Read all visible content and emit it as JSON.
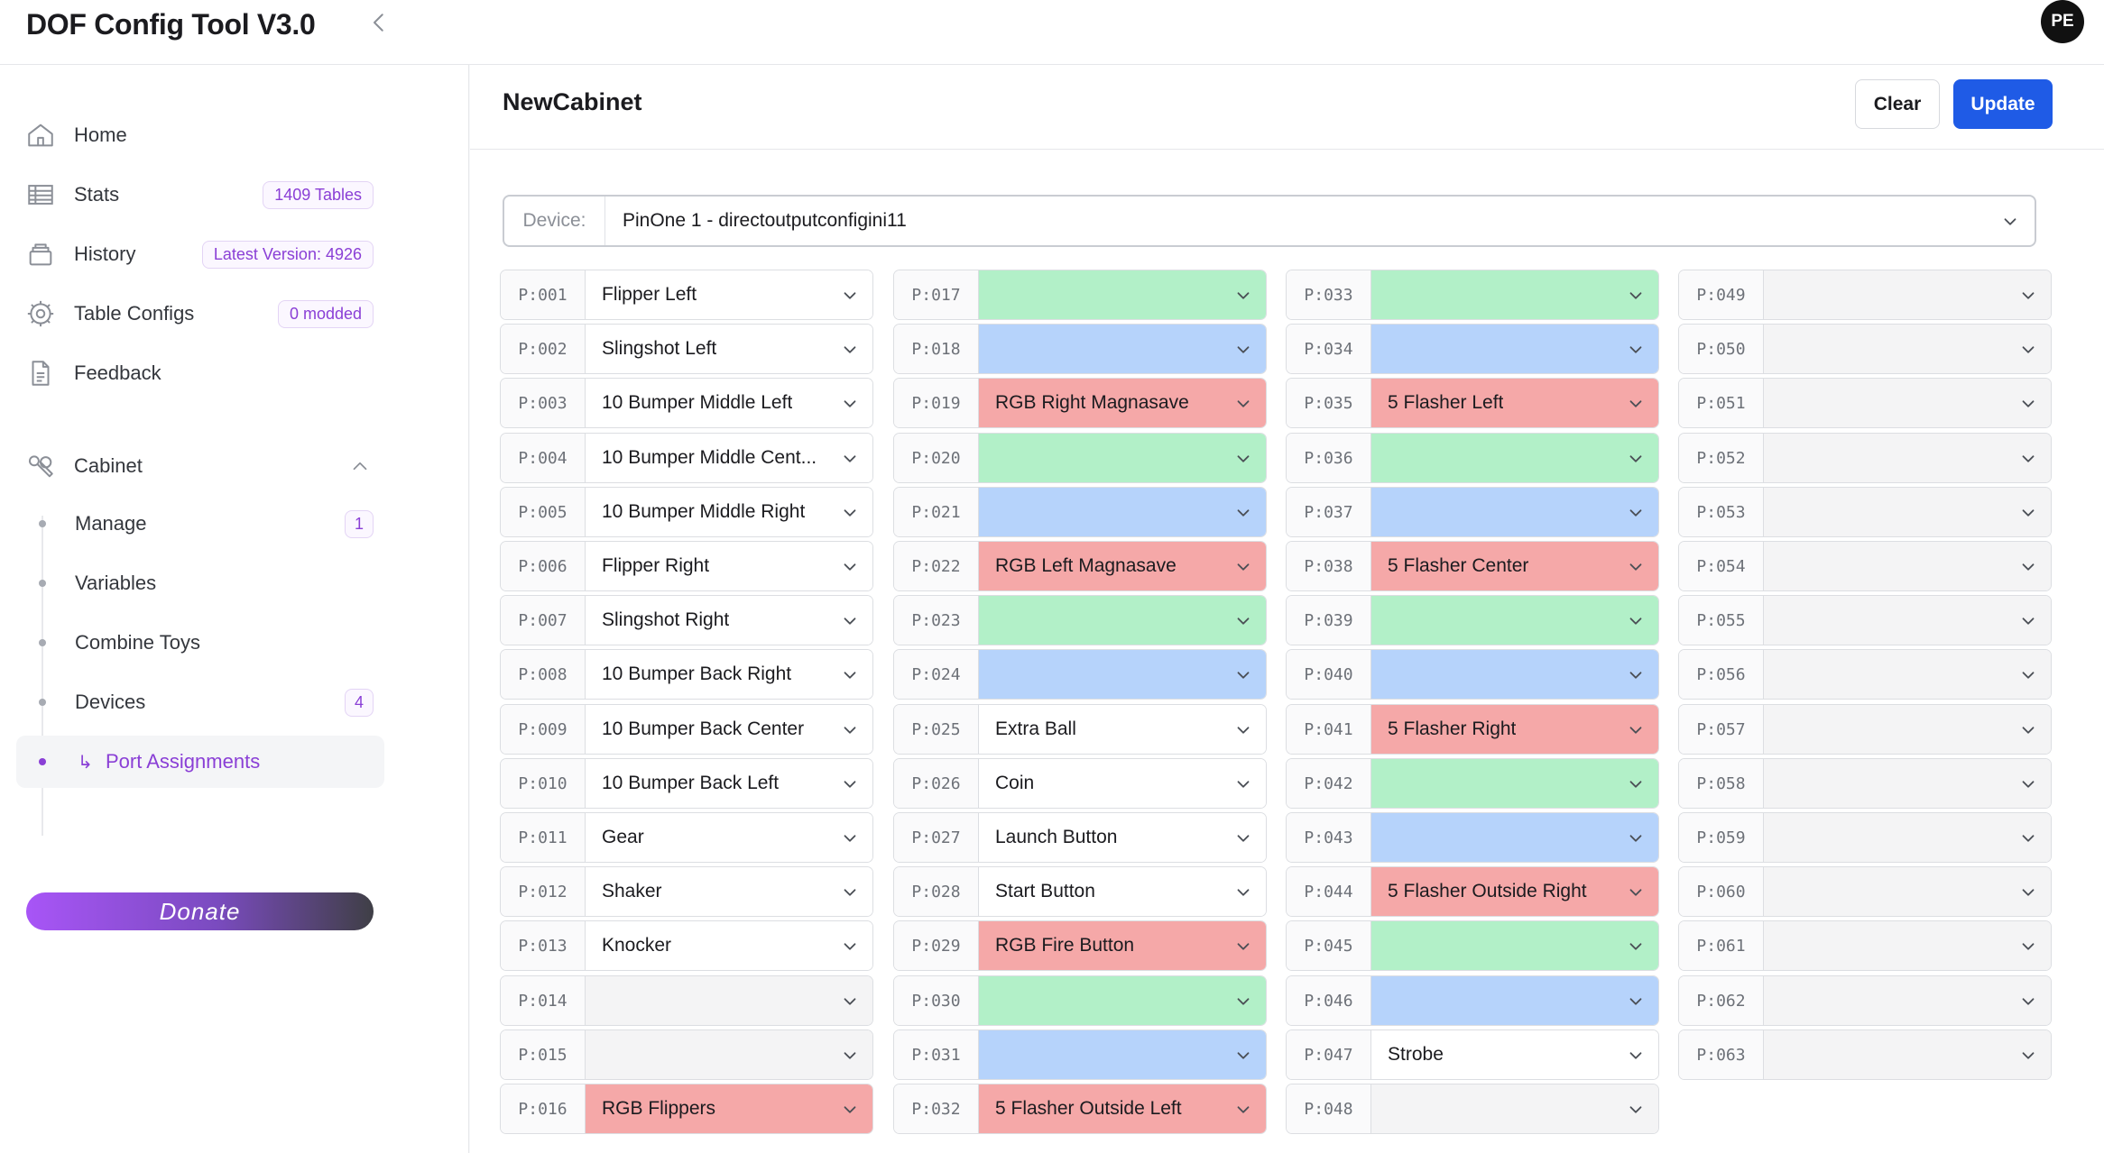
{
  "app": {
    "title": "DOF Config Tool V3.0",
    "user_initials": "PE"
  },
  "sidebar": {
    "items": [
      {
        "label": "Home",
        "badge": ""
      },
      {
        "label": "Stats",
        "badge": "1409 Tables"
      },
      {
        "label": "History",
        "badge": "Latest Version: 4926"
      },
      {
        "label": "Table Configs",
        "badge": "0 modded"
      },
      {
        "label": "Feedback",
        "badge": ""
      }
    ],
    "cabinet": {
      "label": "Cabinet",
      "sub": [
        {
          "label": "Manage",
          "badge": "1"
        },
        {
          "label": "Variables",
          "badge": ""
        },
        {
          "label": "Combine Toys",
          "badge": ""
        },
        {
          "label": "Devices",
          "badge": "4"
        },
        {
          "label": "Port Assignments",
          "badge": ""
        }
      ]
    },
    "donate_label": "Donate"
  },
  "main": {
    "title": "NewCabinet",
    "clear_label": "Clear",
    "update_label": "Update",
    "device_label": "Device:",
    "device_value": "PinOne 1 - directoutputconfigini11"
  },
  "colors": {
    "accent": "#8a3fd6",
    "primary": "#1f5be6",
    "green": "#b2f0c8",
    "blue": "#b6d3fb",
    "red": "#f5a8a8",
    "empty": "#f4f4f5"
  },
  "ports": [
    {
      "port": "P:001",
      "toy": "Flipper Left",
      "color": "white"
    },
    {
      "port": "P:002",
      "toy": "Slingshot Left",
      "color": "white"
    },
    {
      "port": "P:003",
      "toy": "10 Bumper Middle Left",
      "color": "white"
    },
    {
      "port": "P:004",
      "toy": "10 Bumper Middle Cent...",
      "color": "white"
    },
    {
      "port": "P:005",
      "toy": "10 Bumper Middle Right",
      "color": "white"
    },
    {
      "port": "P:006",
      "toy": "Flipper Right",
      "color": "white"
    },
    {
      "port": "P:007",
      "toy": "Slingshot Right",
      "color": "white"
    },
    {
      "port": "P:008",
      "toy": "10 Bumper Back Right",
      "color": "white"
    },
    {
      "port": "P:009",
      "toy": "10 Bumper Back Center",
      "color": "white"
    },
    {
      "port": "P:010",
      "toy": "10 Bumper Back Left",
      "color": "white"
    },
    {
      "port": "P:011",
      "toy": "Gear",
      "color": "white"
    },
    {
      "port": "P:012",
      "toy": "Shaker",
      "color": "white"
    },
    {
      "port": "P:013",
      "toy": "Knocker",
      "color": "white"
    },
    {
      "port": "P:014",
      "toy": "",
      "color": "empty"
    },
    {
      "port": "P:015",
      "toy": "",
      "color": "empty"
    },
    {
      "port": "P:016",
      "toy": "RGB Flippers",
      "color": "red"
    },
    {
      "port": "P:017",
      "toy": "",
      "color": "green"
    },
    {
      "port": "P:018",
      "toy": "",
      "color": "blue"
    },
    {
      "port": "P:019",
      "toy": "RGB Right Magnasave",
      "color": "red"
    },
    {
      "port": "P:020",
      "toy": "",
      "color": "green"
    },
    {
      "port": "P:021",
      "toy": "",
      "color": "blue"
    },
    {
      "port": "P:022",
      "toy": "RGB Left Magnasave",
      "color": "red"
    },
    {
      "port": "P:023",
      "toy": "",
      "color": "green"
    },
    {
      "port": "P:024",
      "toy": "",
      "color": "blue"
    },
    {
      "port": "P:025",
      "toy": "Extra Ball",
      "color": "white"
    },
    {
      "port": "P:026",
      "toy": "Coin",
      "color": "white"
    },
    {
      "port": "P:027",
      "toy": "Launch Button",
      "color": "white"
    },
    {
      "port": "P:028",
      "toy": "Start Button",
      "color": "white"
    },
    {
      "port": "P:029",
      "toy": "RGB Fire Button",
      "color": "red"
    },
    {
      "port": "P:030",
      "toy": "",
      "color": "green"
    },
    {
      "port": "P:031",
      "toy": "",
      "color": "blue"
    },
    {
      "port": "P:032",
      "toy": "5 Flasher Outside Left",
      "color": "red"
    },
    {
      "port": "P:033",
      "toy": "",
      "color": "green"
    },
    {
      "port": "P:034",
      "toy": "",
      "color": "blue"
    },
    {
      "port": "P:035",
      "toy": "5 Flasher Left",
      "color": "red"
    },
    {
      "port": "P:036",
      "toy": "",
      "color": "green"
    },
    {
      "port": "P:037",
      "toy": "",
      "color": "blue"
    },
    {
      "port": "P:038",
      "toy": "5 Flasher Center",
      "color": "red"
    },
    {
      "port": "P:039",
      "toy": "",
      "color": "green"
    },
    {
      "port": "P:040",
      "toy": "",
      "color": "blue"
    },
    {
      "port": "P:041",
      "toy": "5 Flasher Right",
      "color": "red"
    },
    {
      "port": "P:042",
      "toy": "",
      "color": "green"
    },
    {
      "port": "P:043",
      "toy": "",
      "color": "blue"
    },
    {
      "port": "P:044",
      "toy": "5 Flasher Outside Right",
      "color": "red"
    },
    {
      "port": "P:045",
      "toy": "",
      "color": "green"
    },
    {
      "port": "P:046",
      "toy": "",
      "color": "blue"
    },
    {
      "port": "P:047",
      "toy": "Strobe",
      "color": "white"
    },
    {
      "port": "P:048",
      "toy": "",
      "color": "empty"
    },
    {
      "port": "P:049",
      "toy": "",
      "color": "empty"
    },
    {
      "port": "P:050",
      "toy": "",
      "color": "empty"
    },
    {
      "port": "P:051",
      "toy": "",
      "color": "empty"
    },
    {
      "port": "P:052",
      "toy": "",
      "color": "empty"
    },
    {
      "port": "P:053",
      "toy": "",
      "color": "empty"
    },
    {
      "port": "P:054",
      "toy": "",
      "color": "empty"
    },
    {
      "port": "P:055",
      "toy": "",
      "color": "empty"
    },
    {
      "port": "P:056",
      "toy": "",
      "color": "empty"
    },
    {
      "port": "P:057",
      "toy": "",
      "color": "empty"
    },
    {
      "port": "P:058",
      "toy": "",
      "color": "empty"
    },
    {
      "port": "P:059",
      "toy": "",
      "color": "empty"
    },
    {
      "port": "P:060",
      "toy": "",
      "color": "empty"
    },
    {
      "port": "P:061",
      "toy": "",
      "color": "empty"
    },
    {
      "port": "P:062",
      "toy": "",
      "color": "empty"
    },
    {
      "port": "P:063",
      "toy": "",
      "color": "empty"
    }
  ]
}
